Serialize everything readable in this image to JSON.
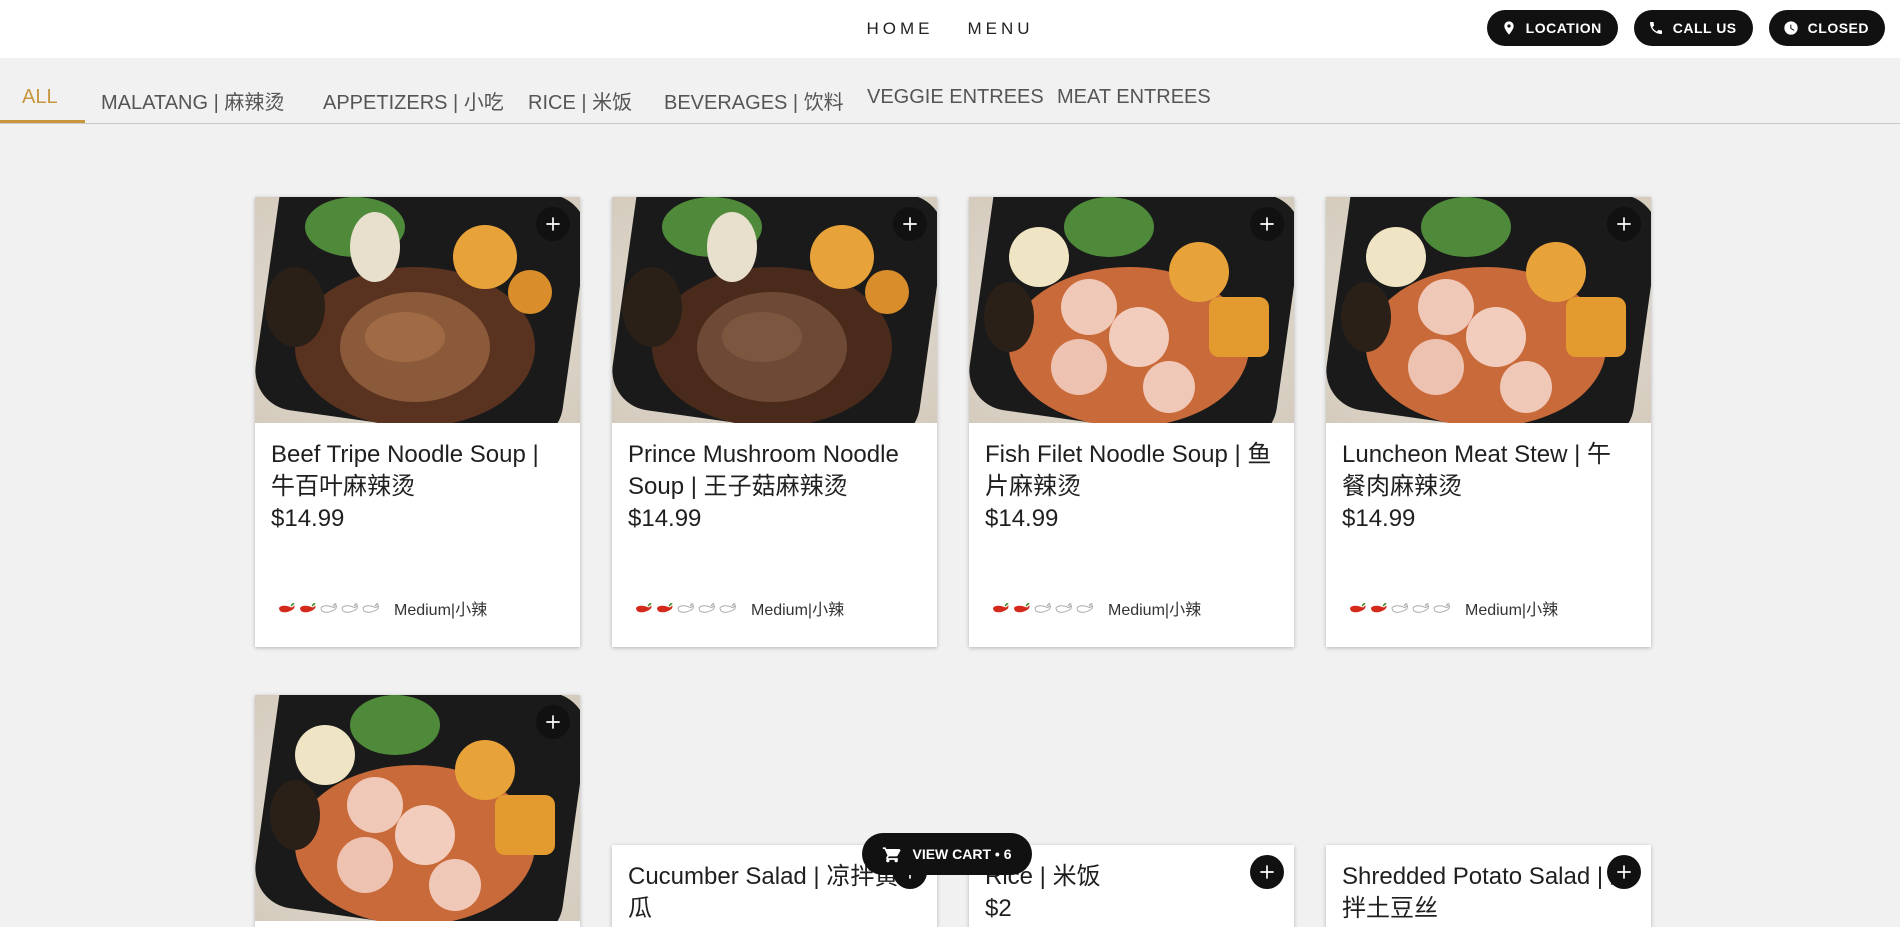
{
  "nav": {
    "home": "HOME",
    "menu": "MENU"
  },
  "actions": {
    "location": "LOCATION",
    "call": "CALL US",
    "status": "CLOSED"
  },
  "categories": [
    "ALL",
    "MALATANG | 麻辣烫",
    "APPETIZERS | 小吃",
    "RICE | 米饭",
    "BEVERAGES | 饮料",
    "VEGGIE ENTREES",
    "MEAT ENTREES"
  ],
  "active_category": "ALL",
  "items": [
    {
      "name": "Beef Tripe Noodle Soup | 牛百叶麻辣烫",
      "price": "$14.99",
      "spice_level": 2,
      "spice_max": 5,
      "spice_label": "Medium|小辣"
    },
    {
      "name": "Prince Mushroom Noodle Soup | 王子菇麻辣烫",
      "price": "$14.99",
      "spice_level": 2,
      "spice_max": 5,
      "spice_label": "Medium|小辣"
    },
    {
      "name": "Fish Filet Noodle Soup | 鱼片麻辣烫",
      "price": "$14.99",
      "spice_level": 2,
      "spice_max": 5,
      "spice_label": "Medium|小辣"
    },
    {
      "name": "Luncheon Meat Stew | 午餐肉麻辣烫",
      "price": "$14.99",
      "spice_level": 2,
      "spice_max": 5,
      "spice_label": "Medium|小辣"
    },
    {
      "name": "Cucumber Salad | 凉拌黄瓜"
    },
    {
      "name": "Rice | 米饭",
      "price": "$2"
    },
    {
      "name": "Shredded Potato Salad | 凉拌土豆丝"
    }
  ],
  "cart": {
    "label": "VIEW CART • 6"
  },
  "colors": {
    "accent": "#c8963e",
    "dark": "#111111",
    "background": "#f1f1f1"
  }
}
